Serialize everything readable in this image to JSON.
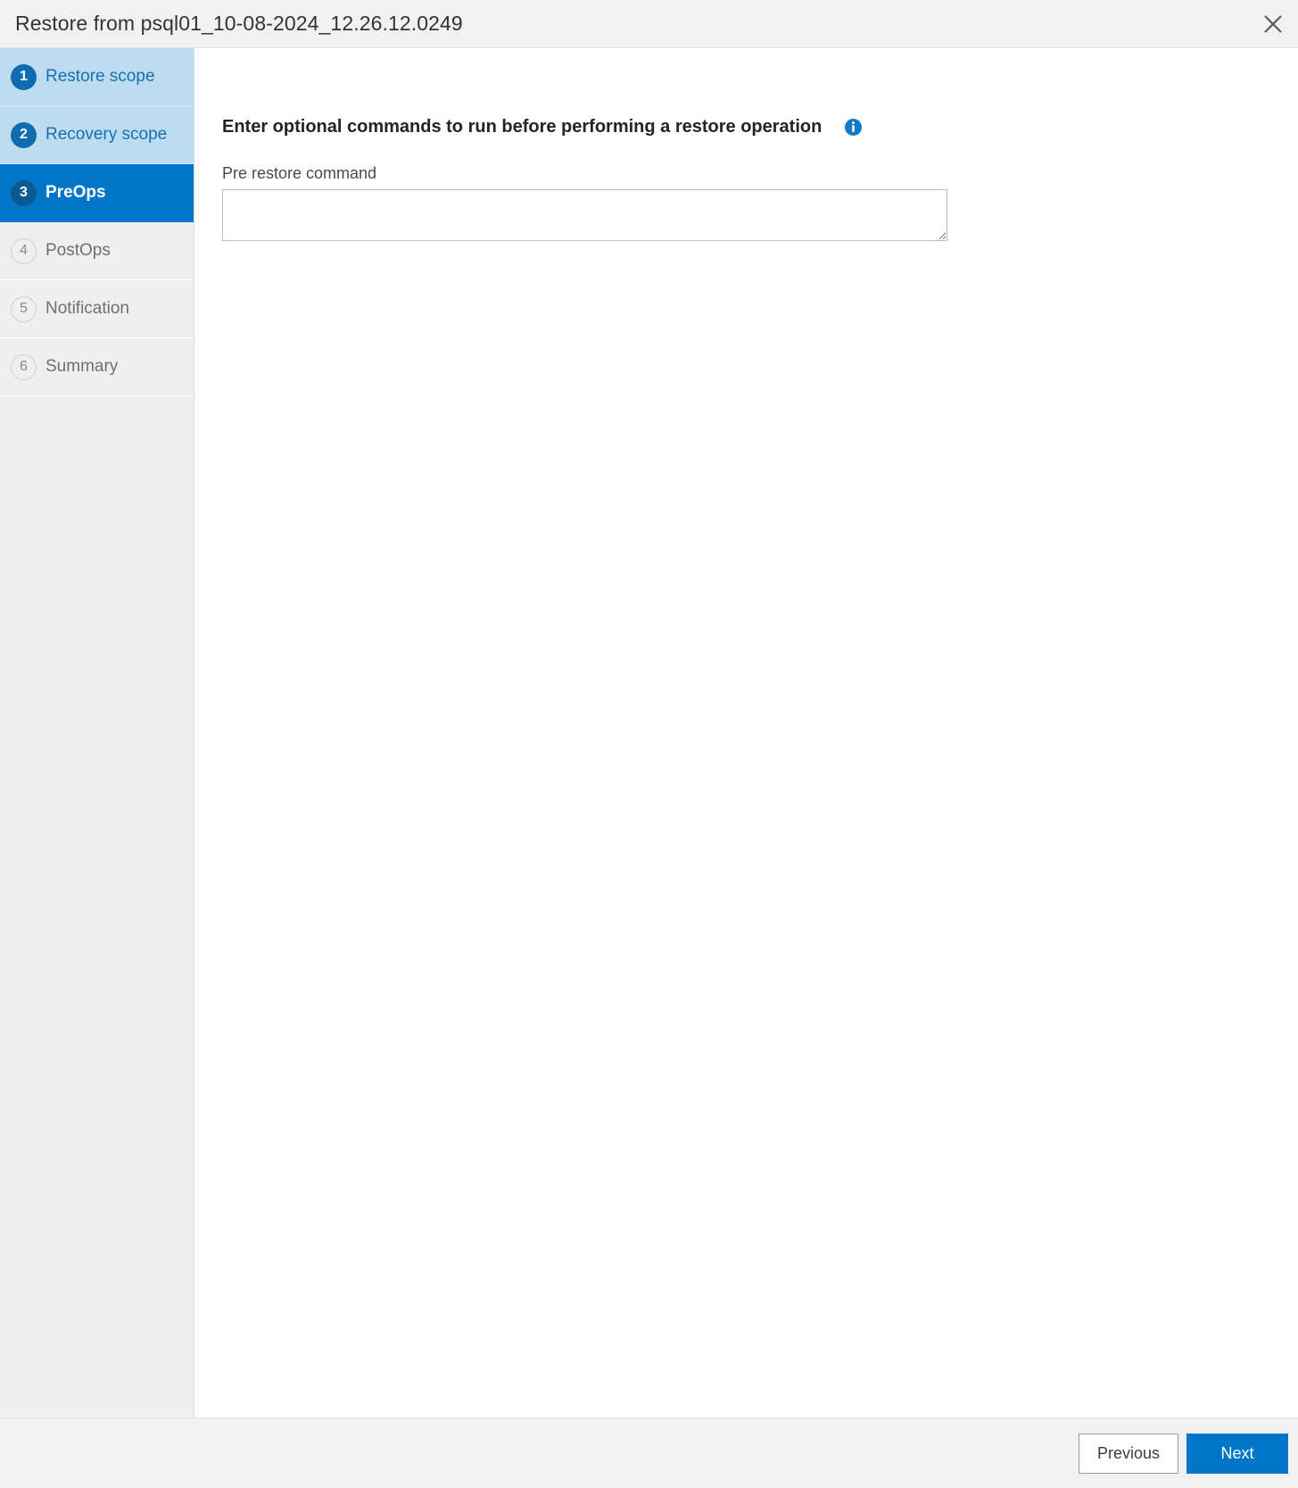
{
  "dialog": {
    "title": "Restore from psql01_10-08-2024_12.26.12.0249",
    "close_icon": "close-icon"
  },
  "sidebar": {
    "steps": [
      {
        "number": "1",
        "label": "Restore scope",
        "state": "completed"
      },
      {
        "number": "2",
        "label": "Recovery scope",
        "state": "completed"
      },
      {
        "number": "3",
        "label": "PreOps",
        "state": "active"
      },
      {
        "number": "4",
        "label": "PostOps",
        "state": "inactive"
      },
      {
        "number": "5",
        "label": "Notification",
        "state": "inactive"
      },
      {
        "number": "6",
        "label": "Summary",
        "state": "inactive"
      }
    ]
  },
  "main": {
    "heading": "Enter optional commands to run before performing a restore operation",
    "info_icon": "info-icon",
    "pre_restore": {
      "label": "Pre restore command",
      "value": "",
      "placeholder": ""
    }
  },
  "footer": {
    "previous_label": "Previous",
    "next_label": "Next"
  },
  "colors": {
    "accent_blue": "#0176c8",
    "active_badge_blue": "#0a5a94",
    "completed_bg": "#bcdcf0",
    "completed_text": "#176fb5",
    "chrome_gray": "#f1f1f1",
    "sidebar_gray": "#efefef"
  }
}
